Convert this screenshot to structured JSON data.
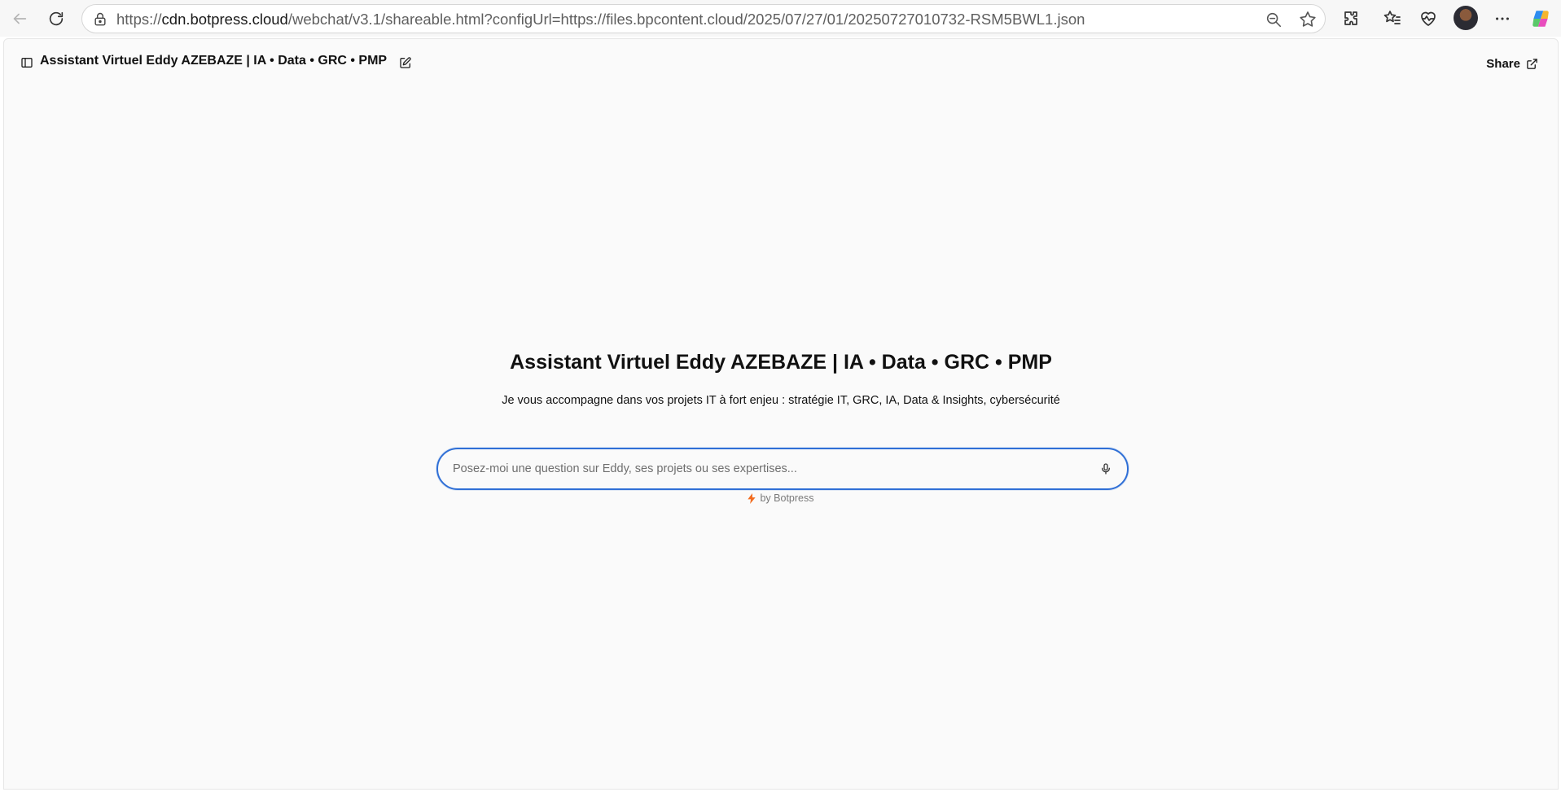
{
  "browser": {
    "url_prefix": "https://",
    "url_host": "cdn.botpress.cloud",
    "url_path": "/webchat/v3.1/shareable.html?configUrl=https://files.bpcontent.cloud/2025/07/27/01/20250727010732-RSM5BWL1.json"
  },
  "chat": {
    "header_title": "Assistant Virtuel Eddy AZEBAZE | IA • Data • GRC • PMP",
    "share_label": "Share",
    "hero_title": "Assistant Virtuel Eddy AZEBAZE | IA • Data • GRC • PMP",
    "hero_subtitle": "Je vous accompagne dans vos projets IT à fort enjeu : stratégie IT, GRC, IA, Data & Insights, cybersécurité",
    "input_placeholder": "Posez-moi une question sur Eddy, ses projets ou ses expertises...",
    "input_value": "",
    "branding": "by Botpress"
  },
  "colors": {
    "accent": "#2f6fd6",
    "branding_bolt": "#f26b1d",
    "page_bg": "#fafafa"
  },
  "icons": {
    "back": "arrow-left-icon",
    "reload": "reload-icon",
    "site_info": "lock-icon",
    "zoom": "zoom-out-icon",
    "favorite": "star-icon",
    "extensions": "puzzle-icon",
    "favorites": "favorites-list-icon",
    "health": "heart-pulse-icon",
    "more": "more-icon",
    "copilot": "copilot-icon",
    "sidebar": "sidebar-toggle-icon",
    "edit": "edit-icon",
    "share": "external-link-icon",
    "mic": "microphone-icon",
    "bolt": "bolt-icon"
  }
}
